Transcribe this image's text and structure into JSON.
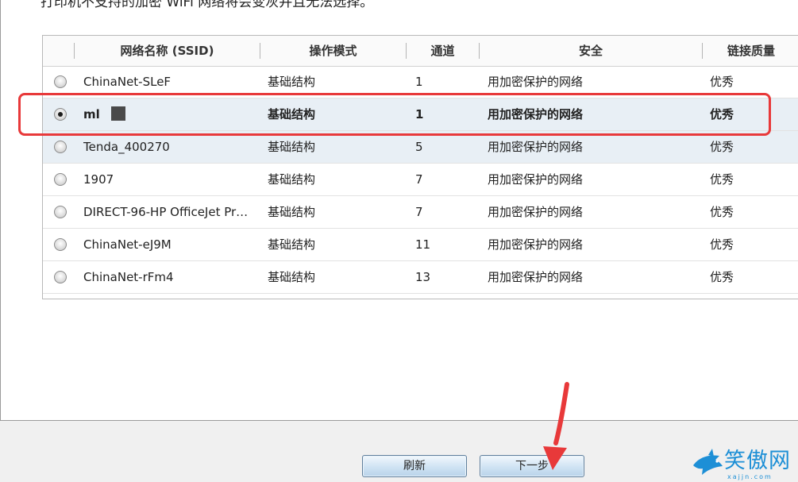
{
  "instruction_text": "打印机不支持的加密 WiFi 网络将会变灰并且无法选择。",
  "columns": [
    "网络名称 (SSID)",
    "操作模式",
    "通道",
    "安全",
    "链接质量"
  ],
  "networks": [
    {
      "ssid": "ChinaNet-SLeF",
      "mode": "基础结构",
      "channel": "1",
      "security": "用加密保护的网络",
      "quality": "优秀",
      "selected": false
    },
    {
      "ssid": "ml",
      "mode": "基础结构",
      "channel": "1",
      "security": "用加密保护的网络",
      "quality": "优秀",
      "selected": true
    },
    {
      "ssid": "Tenda_400270",
      "mode": "基础结构",
      "channel": "5",
      "security": "用加密保护的网络",
      "quality": "优秀",
      "selected": false
    },
    {
      "ssid": "1907",
      "mode": "基础结构",
      "channel": "7",
      "security": "用加密保护的网络",
      "quality": "优秀",
      "selected": false
    },
    {
      "ssid": "DIRECT-96-HP OfficeJet Pr…",
      "mode": "基础结构",
      "channel": "7",
      "security": "用加密保护的网络",
      "quality": "优秀",
      "selected": false
    },
    {
      "ssid": "ChinaNet-eJ9M",
      "mode": "基础结构",
      "channel": "11",
      "security": "用加密保护的网络",
      "quality": "优秀",
      "selected": false
    },
    {
      "ssid": "ChinaNet-rFm4",
      "mode": "基础结构",
      "channel": "13",
      "security": "用加密保护的网络",
      "quality": "优秀",
      "selected": false
    }
  ],
  "buttons": {
    "refresh": "刷新",
    "next": "下一步"
  },
  "watermark": {
    "title": "笑傲网",
    "url": "xajjn.com"
  },
  "colors": {
    "highlight": "#e8393a",
    "selected_row": "#e8eff5",
    "logo": "#1d8fd6"
  }
}
